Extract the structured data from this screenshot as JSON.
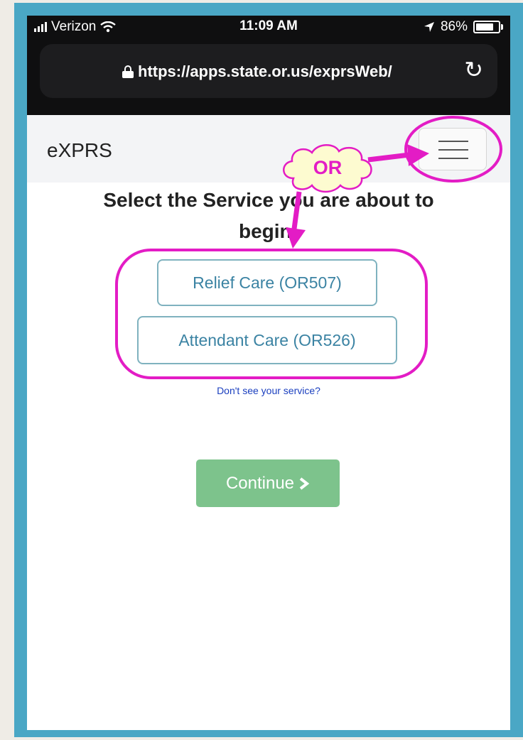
{
  "status_bar": {
    "carrier": "Verizon",
    "time": "11:09 AM",
    "battery": "86%"
  },
  "browser": {
    "url": "https://apps.state.or.us/exprsWeb/"
  },
  "app": {
    "brand": "eXPRS"
  },
  "page": {
    "headline_line1": "Select the Service you are about to",
    "headline_line2": "begin:",
    "services": [
      {
        "label": "Relief Care (OR507)"
      },
      {
        "label": "Attendant Care (OR526)"
      }
    ],
    "help_link": "Don't see your service?",
    "continue_label": "Continue"
  },
  "annotation": {
    "callout_text": "OR",
    "color": "#e31cc5"
  },
  "colors": {
    "frame": "#4aa7c5",
    "continue_bg": "#7dc38c",
    "service_text": "#3b83a3"
  }
}
